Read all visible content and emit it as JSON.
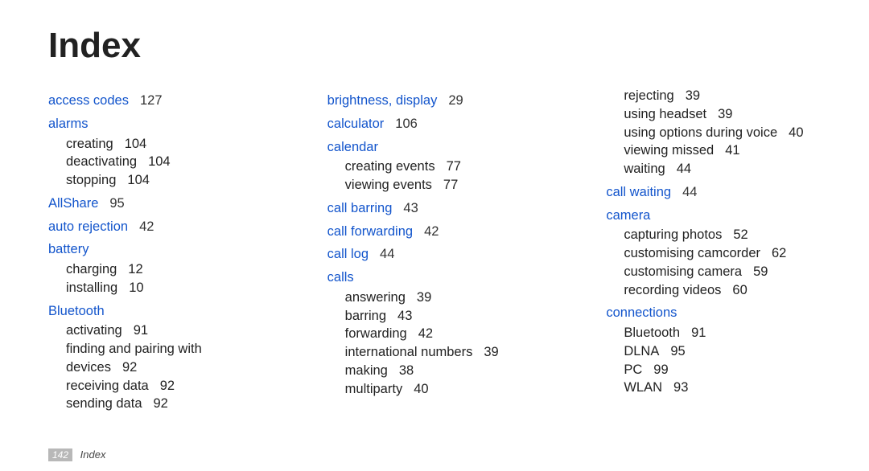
{
  "title": "Index",
  "footer": {
    "page_number": "142",
    "label": "Index"
  },
  "columns": [
    [
      {
        "type": "term",
        "text": "access codes",
        "page": "127"
      },
      {
        "type": "term",
        "text": "alarms"
      },
      {
        "type": "sub",
        "text": "creating",
        "page": "104"
      },
      {
        "type": "sub",
        "text": "deactivating",
        "page": "104"
      },
      {
        "type": "sub",
        "text": "stopping",
        "page": "104"
      },
      {
        "type": "term",
        "text": "AllShare",
        "page": "95"
      },
      {
        "type": "term",
        "text": "auto rejection",
        "page": "42"
      },
      {
        "type": "term",
        "text": "battery"
      },
      {
        "type": "sub",
        "text": "charging",
        "page": "12"
      },
      {
        "type": "sub",
        "text": "installing",
        "page": "10"
      },
      {
        "type": "term",
        "text": "Bluetooth"
      },
      {
        "type": "sub",
        "text": "activating",
        "page": "91"
      },
      {
        "type": "sub",
        "text": "finding and pairing with devices",
        "page": "92"
      },
      {
        "type": "sub",
        "text": "receiving data",
        "page": "92"
      },
      {
        "type": "sub",
        "text": "sending data",
        "page": "92"
      }
    ],
    [
      {
        "type": "term",
        "text": "brightness, display",
        "page": "29"
      },
      {
        "type": "term",
        "text": "calculator",
        "page": "106"
      },
      {
        "type": "term",
        "text": "calendar"
      },
      {
        "type": "sub",
        "text": "creating events",
        "page": "77"
      },
      {
        "type": "sub",
        "text": "viewing events",
        "page": "77"
      },
      {
        "type": "term",
        "text": "call barring",
        "page": "43"
      },
      {
        "type": "term",
        "text": "call forwarding",
        "page": "42"
      },
      {
        "type": "term",
        "text": "call log",
        "page": "44"
      },
      {
        "type": "term",
        "text": "calls"
      },
      {
        "type": "sub",
        "text": "answering",
        "page": "39"
      },
      {
        "type": "sub",
        "text": "barring",
        "page": "43"
      },
      {
        "type": "sub",
        "text": "forwarding",
        "page": "42"
      },
      {
        "type": "sub",
        "text": "international numbers",
        "page": "39"
      },
      {
        "type": "sub",
        "text": "making",
        "page": "38"
      },
      {
        "type": "sub",
        "text": "multiparty",
        "page": "40"
      }
    ],
    [
      {
        "type": "sub",
        "text": "rejecting",
        "page": "39"
      },
      {
        "type": "sub",
        "text": "using headset",
        "page": "39"
      },
      {
        "type": "sub",
        "text": "using options during voice",
        "page": "40"
      },
      {
        "type": "sub",
        "text": "viewing missed",
        "page": "41"
      },
      {
        "type": "sub",
        "text": "waiting",
        "page": "44"
      },
      {
        "type": "term",
        "text": "call waiting",
        "page": "44"
      },
      {
        "type": "term",
        "text": "camera"
      },
      {
        "type": "sub",
        "text": "capturing photos",
        "page": "52"
      },
      {
        "type": "sub",
        "text": "customising camcorder",
        "page": "62"
      },
      {
        "type": "sub",
        "text": "customising camera",
        "page": "59"
      },
      {
        "type": "sub",
        "text": "recording videos",
        "page": "60"
      },
      {
        "type": "term",
        "text": "connections"
      },
      {
        "type": "sub",
        "text": "Bluetooth",
        "page": "91"
      },
      {
        "type": "sub",
        "text": "DLNA",
        "page": "95"
      },
      {
        "type": "sub",
        "text": "PC",
        "page": "99"
      },
      {
        "type": "sub",
        "text": "WLAN",
        "page": "93"
      }
    ]
  ]
}
